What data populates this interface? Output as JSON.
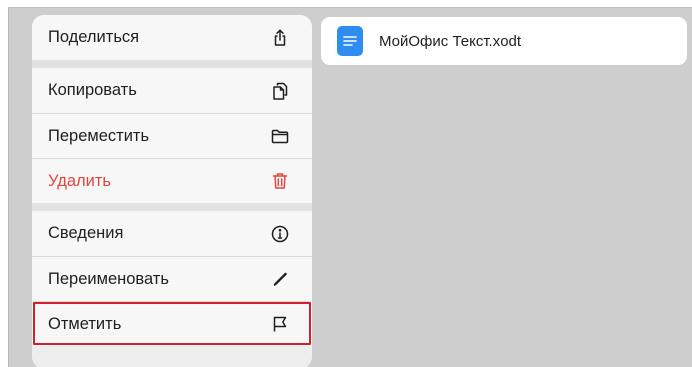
{
  "file": {
    "name": "МойОфис Текст.xodt",
    "icon": "document-icon"
  },
  "menu": {
    "share": {
      "label": "Поделиться",
      "icon": "share-icon"
    },
    "copy": {
      "label": "Копировать",
      "icon": "copy-icon"
    },
    "move": {
      "label": "Переместить",
      "icon": "folder-icon"
    },
    "delete": {
      "label": "Удалить",
      "icon": "trash-icon",
      "color": "#e2473f"
    },
    "info": {
      "label": "Сведения",
      "icon": "info-icon"
    },
    "rename": {
      "label": "Переименовать",
      "icon": "pencil-icon"
    },
    "flag": {
      "label": "Отметить",
      "icon": "flag-icon",
      "highlighted": true
    }
  },
  "colors": {
    "accent": "#2f8cf0",
    "danger": "#e2473f",
    "highlight_frame": "#d2202f"
  }
}
